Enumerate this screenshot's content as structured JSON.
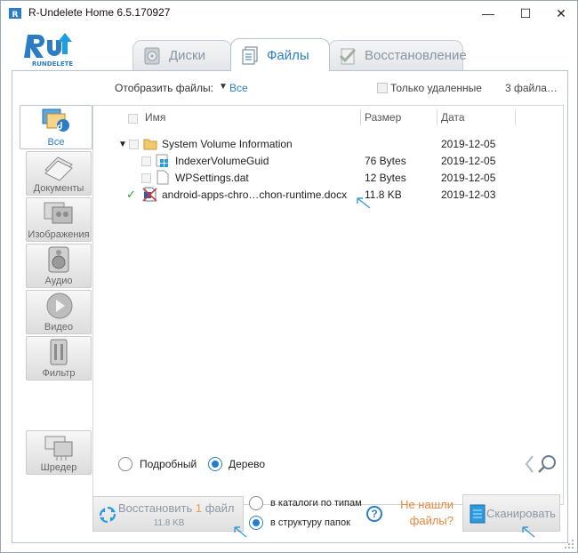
{
  "window": {
    "title": "R-Undelete Home 6.5.170927",
    "minimize_glyph": "—",
    "maximize_glyph": "☐",
    "close_glyph": "✕"
  },
  "logo": {
    "name": "rundelete-logo",
    "text": "RUNDELETE"
  },
  "tabs": [
    {
      "label": "Диски",
      "icon": "disk-icon",
      "active": false
    },
    {
      "label": "Файлы",
      "icon": "files-icon",
      "active": true
    },
    {
      "label": "Восстановление",
      "icon": "restore-check-icon",
      "active": false
    }
  ],
  "filter": {
    "label": "Отобразить файлы:",
    "dropdown_arrow": "▼",
    "value": "Все",
    "only_deleted_label": "Только удаленные",
    "only_deleted_checked": false,
    "file_count": "3 файла…"
  },
  "categories": [
    {
      "label": "Все",
      "icon": "all-files-icon",
      "active": true
    },
    {
      "label": "Документы",
      "icon": "documents-icon",
      "active": false
    },
    {
      "label": "Изображения",
      "icon": "images-icon",
      "active": false
    },
    {
      "label": "Аудио",
      "icon": "audio-icon",
      "active": false
    },
    {
      "label": "Видео",
      "icon": "video-icon",
      "active": false
    },
    {
      "label": "Фильтр",
      "icon": "filter-icon",
      "active": false
    },
    {
      "label": "Шредер",
      "icon": "shredder-icon",
      "active": false
    }
  ],
  "table": {
    "columns": [
      "Имя",
      "Размер",
      "Дата"
    ],
    "rows": [
      {
        "name": "System Volume Information",
        "size": "",
        "date": "2019-12-05",
        "type": "folder",
        "expanded": true,
        "checked": false
      },
      {
        "name": "IndexerVolumeGuid",
        "size": "76 Bytes",
        "date": "2019-12-05",
        "type": "system-file",
        "checked": false
      },
      {
        "name": "WPSettings.dat",
        "size": "12 Bytes",
        "date": "2019-12-05",
        "type": "file",
        "checked": false
      },
      {
        "name": "android-apps-chro…chon-runtime.docx",
        "size": "11.8 KB",
        "date": "2019-12-03",
        "type": "deleted-docx",
        "checked": true
      }
    ],
    "expand_glyph": "▼",
    "check_glyph": "✓"
  },
  "view_mode": {
    "options": [
      "Подробный",
      "Дерево"
    ],
    "selected": "Дерево"
  },
  "restore": {
    "prefix": "Восстановить ",
    "count": "1",
    "suffix": " файл",
    "size": "11.8 KB",
    "options": [
      "в каталоги по типам",
      "в структуру папок"
    ],
    "selected": "в структуру папок"
  },
  "help_glyph": "?",
  "not_found": {
    "line1": "Не нашли",
    "line2": "файлы?"
  },
  "scan_label": "Сканировать",
  "colors": {
    "accent": "#2b7ec6",
    "orange": "#e8873a",
    "disabled_text": "#8c98a4"
  }
}
